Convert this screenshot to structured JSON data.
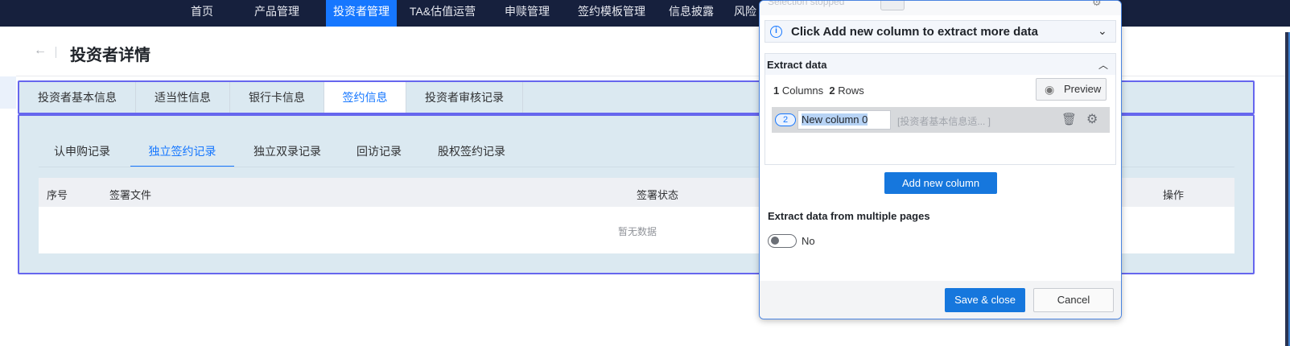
{
  "topnav": {
    "items": [
      {
        "label": "首页"
      },
      {
        "label": "产品管理"
      },
      {
        "label": "投资者管理"
      },
      {
        "label": "TA&估值运营"
      },
      {
        "label": "申赎管理"
      },
      {
        "label": "签约模板管理"
      },
      {
        "label": "信息披露"
      },
      {
        "label": "风险"
      }
    ],
    "active_index": 2
  },
  "page": {
    "back_icon": "arrow-left-icon",
    "title": "投资者详情"
  },
  "tabs": [
    {
      "label": "投资者基本信息"
    },
    {
      "label": "适当性信息"
    },
    {
      "label": "银行卡信息"
    },
    {
      "label": "签约信息"
    },
    {
      "label": "投资者审核记录"
    }
  ],
  "active_tab": "签约信息",
  "subtabs": [
    {
      "label": "认申购记录"
    },
    {
      "label": "独立签约记录"
    },
    {
      "label": "独立双录记录"
    },
    {
      "label": "回访记录"
    },
    {
      "label": "股权签约记录"
    }
  ],
  "active_subtab": "独立签约记录",
  "table": {
    "columns": [
      "序号",
      "签署文件",
      "签署状态",
      "操作"
    ],
    "empty_text": "暂无数据"
  },
  "panel": {
    "top_status": "Selection stopped",
    "info_text": "Click Add new column to extract more data",
    "extract_title": "Extract data",
    "columns_count": "1",
    "columns_label": "Columns",
    "rows_count": "2",
    "rows_label": "Rows",
    "preview_label": "Preview",
    "column": {
      "badge": "2",
      "name": "New column 0",
      "hint": "[投资者基本信息适...    ]"
    },
    "add_column_label": "Add new column",
    "multi_pages_title": "Extract data from multiple pages",
    "multi_pages_value": "No",
    "save_label": "Save & close",
    "cancel_label": "Cancel"
  },
  "colors": {
    "nav_bg": "#16203d",
    "accent": "#1677ff",
    "highlight_border": "#6666ee",
    "highlight_fill": "#dbe9f1"
  }
}
